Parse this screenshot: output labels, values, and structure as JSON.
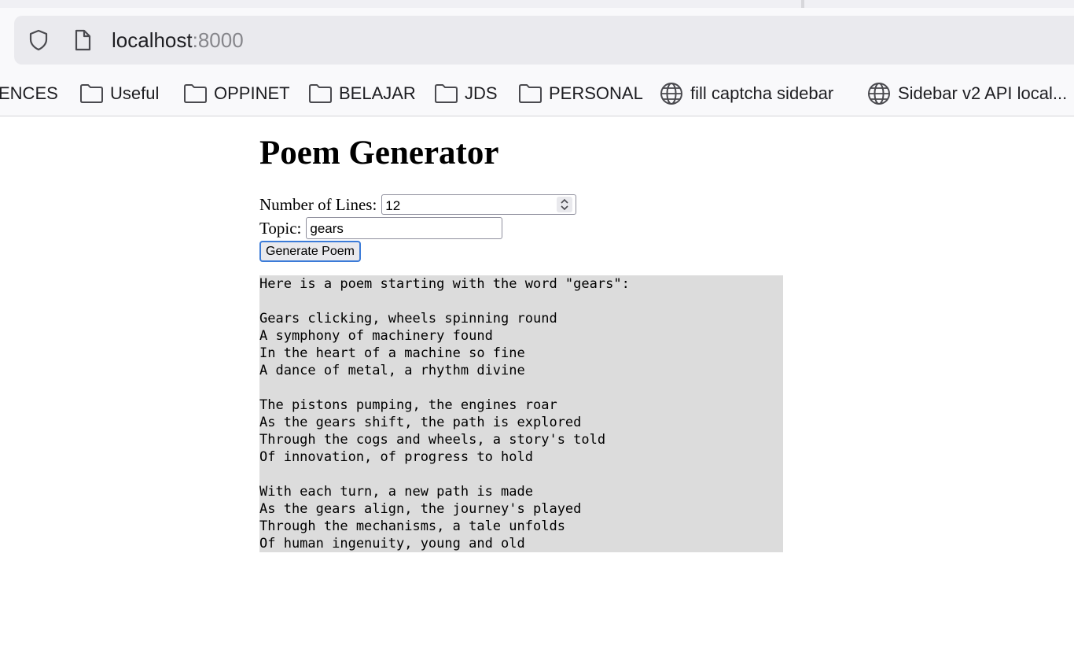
{
  "browser": {
    "url_host": "localhost",
    "url_port": ":8000",
    "bookmarks": [
      {
        "label": "ENCES",
        "icon": "folder-icon"
      },
      {
        "label": "Useful",
        "icon": "folder-icon"
      },
      {
        "label": "OPPINET",
        "icon": "folder-icon"
      },
      {
        "label": "BELAJAR",
        "icon": "folder-icon"
      },
      {
        "label": "JDS",
        "icon": "folder-icon"
      },
      {
        "label": "PERSONAL",
        "icon": "folder-icon"
      },
      {
        "label": "fill captcha sidebar",
        "icon": "globe-icon"
      },
      {
        "label": "Sidebar v2 API local...",
        "icon": "globe-icon"
      }
    ]
  },
  "page": {
    "title": "Poem Generator",
    "lines_label": "Number of Lines:",
    "lines_value": "12",
    "topic_label": "Topic:",
    "topic_value": "gears",
    "generate_label": "Generate Poem",
    "poem_text": "Here is a poem starting with the word \"gears\":\n\nGears clicking, wheels spinning round\nA symphony of machinery found\nIn the heart of a machine so fine\nA dance of metal, a rhythm divine\n\nThe pistons pumping, the engines roar\nAs the gears shift, the path is explored\nThrough the cogs and wheels, a story's told\nOf innovation, of progress to hold\n\nWith each turn, a new path is made\nAs the gears align, the journey's played\nThrough the mechanisms, a tale unfolds\nOf human ingenuity, young and old"
  },
  "colors": {
    "poem_background": "#dcdcdc",
    "button_focus_ring": "#3b7bd8",
    "url_port": "#86868b"
  }
}
